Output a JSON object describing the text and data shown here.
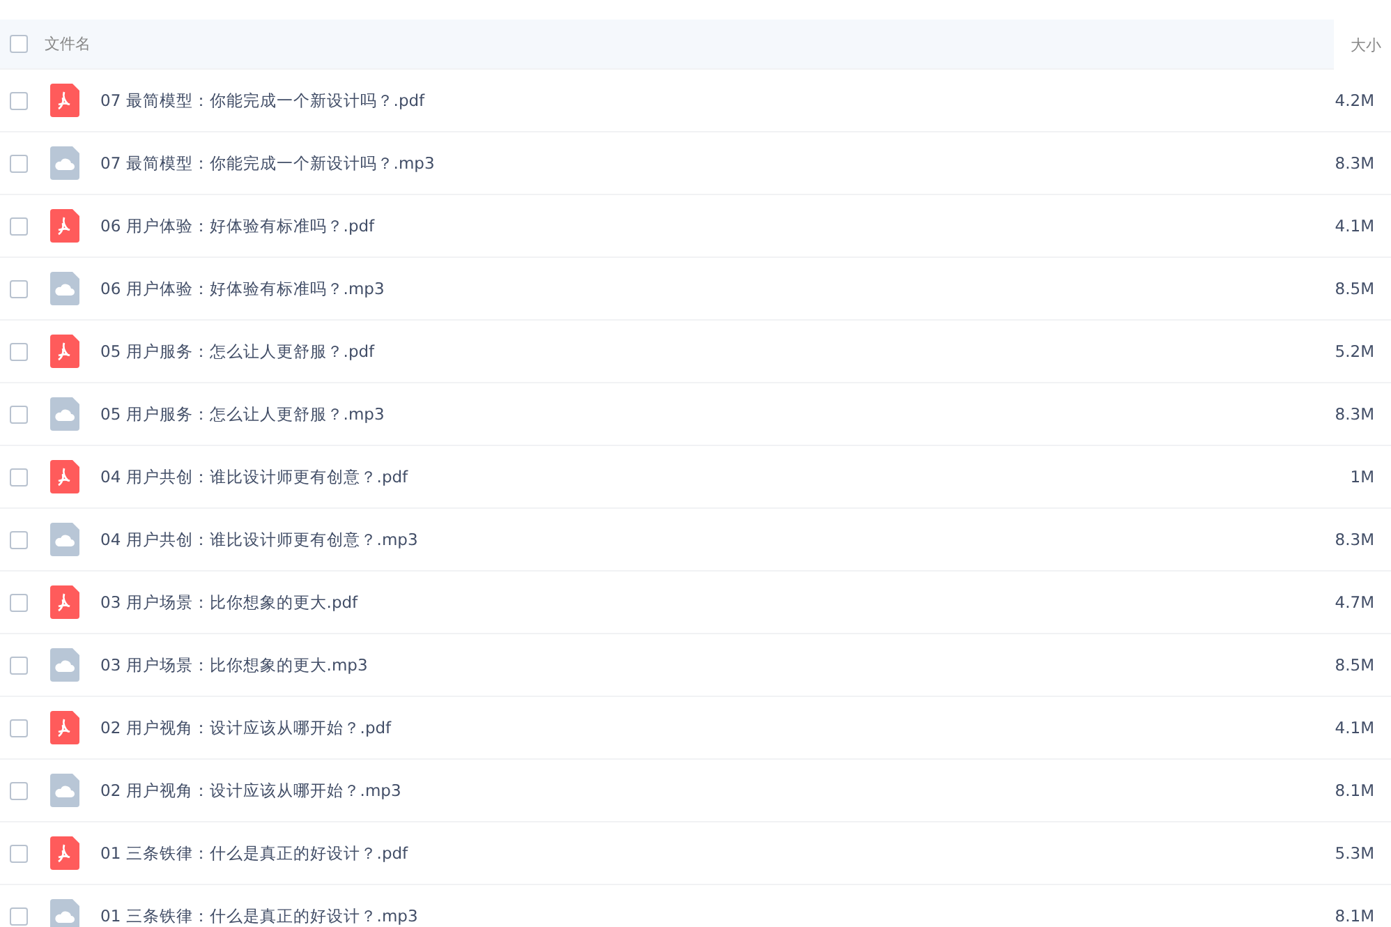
{
  "header": {
    "checked": false,
    "name_column": "文件名",
    "size_column": "大小"
  },
  "files": [
    {
      "kind": "pdf",
      "checked": false,
      "name": "07 最简模型：你能完成一个新设计吗？.pdf",
      "size": "4.2M"
    },
    {
      "kind": "audio",
      "checked": false,
      "name": "07 最简模型：你能完成一个新设计吗？.mp3",
      "size": "8.3M"
    },
    {
      "kind": "pdf",
      "checked": false,
      "name": "06 用户体验：好体验有标准吗？.pdf",
      "size": "4.1M"
    },
    {
      "kind": "audio",
      "checked": false,
      "name": "06 用户体验：好体验有标准吗？.mp3",
      "size": "8.5M"
    },
    {
      "kind": "pdf",
      "checked": false,
      "name": "05 用户服务：怎么让人更舒服？.pdf",
      "size": "5.2M"
    },
    {
      "kind": "audio",
      "checked": false,
      "name": "05 用户服务：怎么让人更舒服？.mp3",
      "size": "8.3M"
    },
    {
      "kind": "pdf",
      "checked": false,
      "name": "04 用户共创：谁比设计师更有创意？.pdf",
      "size": "1M"
    },
    {
      "kind": "audio",
      "checked": false,
      "name": "04 用户共创：谁比设计师更有创意？.mp3",
      "size": "8.3M"
    },
    {
      "kind": "pdf",
      "checked": false,
      "name": "03 用户场景：比你想象的更大.pdf",
      "size": "4.7M"
    },
    {
      "kind": "audio",
      "checked": false,
      "name": "03 用户场景：比你想象的更大.mp3",
      "size": "8.5M"
    },
    {
      "kind": "pdf",
      "checked": false,
      "name": "02 用户视角：设计应该从哪开始？.pdf",
      "size": "4.1M"
    },
    {
      "kind": "audio",
      "checked": false,
      "name": "02 用户视角：设计应该从哪开始？.mp3",
      "size": "8.1M"
    },
    {
      "kind": "pdf",
      "checked": false,
      "name": "01 三条铁律：什么是真正的好设计？.pdf",
      "size": "5.3M"
    },
    {
      "kind": "audio",
      "checked": false,
      "name": "01 三条铁律：什么是真正的好设计？.mp3",
      "size": "8.1M"
    }
  ]
}
